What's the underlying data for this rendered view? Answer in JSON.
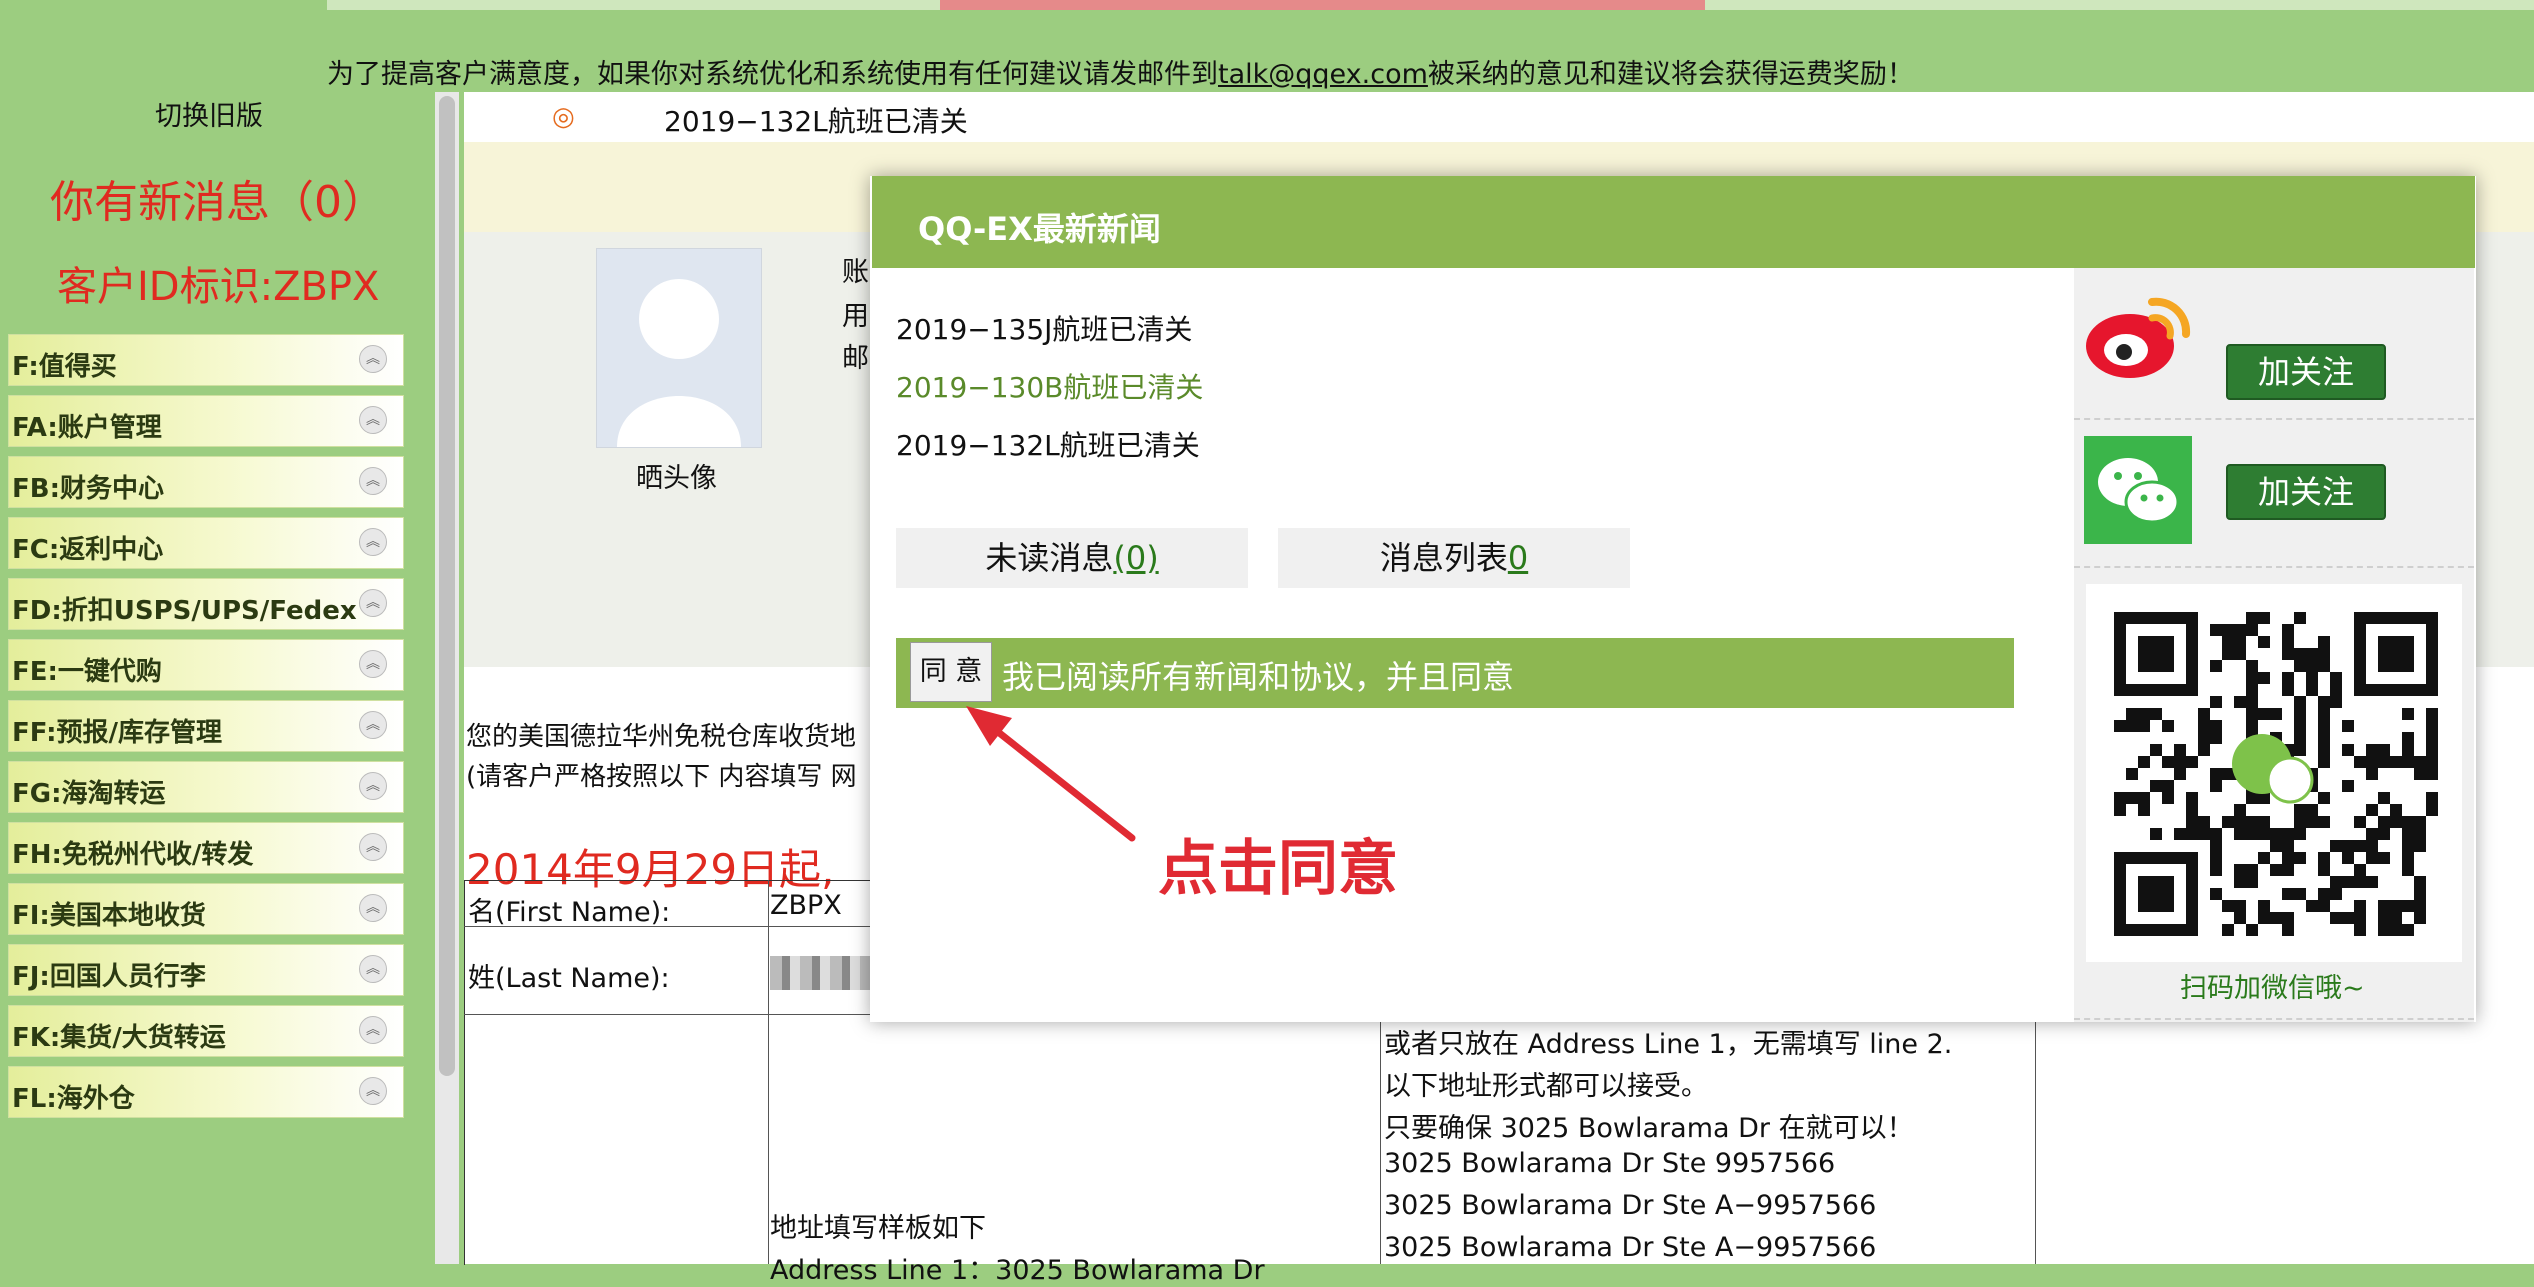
{
  "banner": {
    "notice_before": "为了提高客户满意度，如果你对系统优化和系统使用有任何建议请发邮件到",
    "notice_email": "talk@qqex.com",
    "notice_after": "被采纳的意见和建议将会获得运费奖励！"
  },
  "sidebar": {
    "old_version": "切换旧版",
    "new_message": "你有新消息（0）",
    "client_id": "客户ID标识:ZBPX",
    "items": [
      {
        "label": "F:值得买"
      },
      {
        "label": "FA:账户管理"
      },
      {
        "label": "FB:财务中心"
      },
      {
        "label": "FC:返利中心"
      },
      {
        "label": "FD:折扣USPS/UPS/Fedex"
      },
      {
        "label": "FE:一键代购"
      },
      {
        "label": "FF:预报/库存管理"
      },
      {
        "label": "FG:海淘转运"
      },
      {
        "label": "FH:免税州代收/转发"
      },
      {
        "label": "FI:美国本地收货"
      },
      {
        "label": "FJ:回国人员行李"
      },
      {
        "label": "FK:集货/大货转运"
      },
      {
        "label": "FL:海外仓"
      }
    ]
  },
  "main": {
    "news_line": "2019−132L航班已清关",
    "avatar_label": "晒头像",
    "account_labels": [
      "账",
      "用",
      "邮"
    ],
    "addr_intro1": "您的美国德拉华州免税仓库收货地",
    "addr_intro2": "(请客户严格按照以下 内容填写 网",
    "date_red": "2014年9月29日起,",
    "first_name_label": "名(First Name):",
    "first_name_value": "ZBPX",
    "last_name_label": "姓(Last Name):",
    "template_label": "地址填写样板如下",
    "template_line": "Address Line 1：3025 Bowlarama Dr",
    "addr_examples": [
      "或者只放在 Address Line 1，无需填写 line 2.",
      "以下地址形式都可以接受。",
      "只要确保 3025 Bowlarama Dr 在就可以！",
      "3025 Bowlarama Dr Ste 9957566",
      "3025 Bowlarama Dr Ste A−9957566",
      "3025 Bowlarama Dr Ste A−9957566"
    ]
  },
  "modal": {
    "title": "QQ-EX最新新闻",
    "news": [
      {
        "text": "2019−135J航班已清关",
        "color": "#111111"
      },
      {
        "text": "2019−130B航班已清关",
        "color": "#5a8a2a"
      },
      {
        "text": "2019−132L航班已清关",
        "color": "#111111"
      }
    ],
    "unread_label": "未读消息",
    "unread_count": "(0)",
    "list_label": "消息列表",
    "list_count": "0",
    "agree_button": "同 意",
    "agree_text": "我已阅读所有新闻和协议，并且同意",
    "follow_weibo": "加关注",
    "follow_wechat": "加关注",
    "scan_text": "扫码加微信哦~"
  },
  "annotation": {
    "click_hint": "点击同意"
  },
  "colors": {
    "page_green": "#9ccd80",
    "header_green": "#8db751",
    "alert_red": "#e02a20",
    "button_green": "#2e7d32"
  }
}
